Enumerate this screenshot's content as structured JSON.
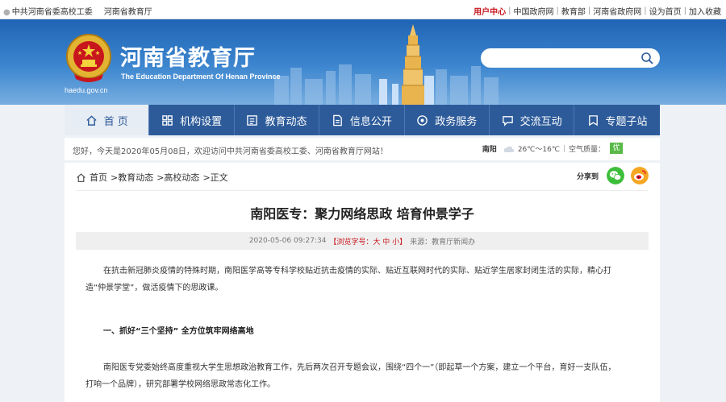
{
  "topbar": {
    "left_links": [
      "中共河南省委高校工委",
      "河南省教育厅"
    ],
    "user_center": "用户中心",
    "right_links": [
      "中国政府网",
      "教育部",
      "河南省政府网",
      "设为首页",
      "加入收藏"
    ]
  },
  "header": {
    "title": "河南省教育厅",
    "subtitle": "The Education Department Of Henan Province",
    "emblem_url": "haedu.gov.cn",
    "search": {
      "placeholder": ""
    }
  },
  "nav": {
    "items": [
      {
        "label": "首 页",
        "icon": "home-icon"
      },
      {
        "label": "机构设置",
        "icon": "org-icon"
      },
      {
        "label": "教育动态",
        "icon": "news-icon"
      },
      {
        "label": "信息公开",
        "icon": "document-icon"
      },
      {
        "label": "政务服务",
        "icon": "service-icon"
      },
      {
        "label": "交流互动",
        "icon": "chat-icon"
      },
      {
        "label": "专题子站",
        "icon": "topic-icon"
      }
    ]
  },
  "infobar": {
    "greeting": "您好，今天是2020年05月08日，欢迎访问中共河南省委高校工委、河南省教育厅网站！",
    "city": "南阳",
    "temperature": "26℃～16℃",
    "air_quality_label": "空气质量：",
    "air_quality_value": "优",
    "colors": {
      "air_quality_badge": "#58b947"
    }
  },
  "breadcrumb": {
    "home": "首页",
    "trail": [
      ">教育动态",
      ">高校动态",
      ">正文"
    ]
  },
  "share": {
    "label": "分享到"
  },
  "article": {
    "title": "南阳医专：聚力网络思政 培育仲景学子",
    "date": "2020-05-06 09:27:34",
    "font_size_label": "【浏览字号：大 中 小】",
    "source": "来源：教育厅新闻办",
    "para1_line1": "在抗击新冠肺炎疫情的特殊时期，南阳医学高等专科学校贴近抗击疫情的实际、贴近互联网时代的实际、贴近学生居家封闭生活的实际，精心打",
    "para1_line2": "造“仲景学堂”，做活疫情下的思政课。",
    "section1": "一、抓好“三个坚持” 全方位筑牢网络高地",
    "para2_line1": "南阳医专党委始终高度重视大学生思想政治教育工作，先后两次召开专题会议，围绕“四个一”（即起草一个方案，建立一个平台，育好一支队伍，",
    "para2_line2": "打响一个品牌），研究部署学校网络思政常态化工作。"
  },
  "colors": {
    "brand_blue": "#2d5b9a",
    "accent_red": "#c8161d"
  }
}
